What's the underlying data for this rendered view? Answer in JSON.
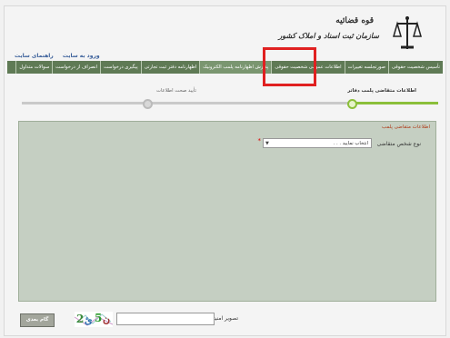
{
  "header": {
    "org_name": "قوه قضائیه",
    "org_subtitle": "سازمان ثبت اسناد و املاک کشور",
    "links": [
      "ورود به سایت",
      "راهنمای سایت"
    ]
  },
  "menu": {
    "items": [
      "تأسیس شخصیت حقوقی",
      "صورتجلسه تغییرات",
      "اطلاعات عمومی شخصیت حقوقی",
      "پذیرش اظهارنامه پلمب الکترونیک",
      "اظهارنامه دفتر ثبت تجارتی",
      "پیگیری درخواست",
      "انصراف از درخواست",
      "سوالات متداول"
    ],
    "highlighted_index": 3
  },
  "steps": {
    "items": [
      {
        "label": "اطلاعات متقاضی پلمب دفاتر",
        "active": true
      },
      {
        "label": "تأیید صحت اطلاعات",
        "active": false
      }
    ]
  },
  "panel": {
    "title": "اطلاعات متقاضی پلمب",
    "field_label": "نوع شخص متقاضی",
    "select_value": "انتخاب نمایید . . .",
    "required_mark": "*"
  },
  "captcha": {
    "label": "تصویر امنیتی",
    "input_value": "",
    "image_text": "2ئ5ن",
    "button_label": "گام بعدی"
  },
  "colors": {
    "menu_bg": "#5f7a55",
    "highlight_border": "#e02020",
    "step_active": "#8bbf3a",
    "panel_bg": "#c5cfc2"
  }
}
